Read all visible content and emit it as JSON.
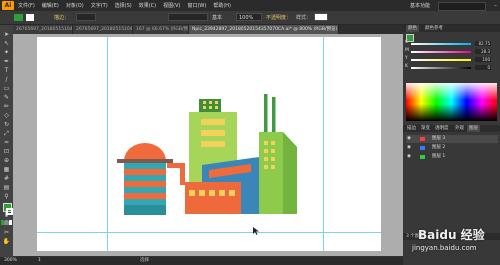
{
  "app": {
    "logo": "Ai"
  },
  "menus": [
    "文件(F)",
    "编辑(E)",
    "对象(O)",
    "文字(T)",
    "选择(S)",
    "效果(C)",
    "视图(V)",
    "窗口(W)",
    "帮助(H)"
  ],
  "workspace": "基本功能",
  "control": {
    "stroke_label": "描边：",
    "stroke_preset": "基本",
    "opacity_label": "不透明度：",
    "opacity_value": "100%",
    "style_label": "样式："
  },
  "tabs": [
    {
      "label": "26765697_2018051510451274.ai* @ 300% (RGB/预览)",
      "active": false
    },
    {
      "label": "26765697_2018051510451274.ai* @ 300%",
      "active": false
    },
    {
      "label": "167 @ 66.67% (RGB/预览)",
      "active": false
    },
    {
      "label": "Npic_23942897_20180520154357070CA.ai* @ 800% (RGB/预览)",
      "active": true
    }
  ],
  "status": {
    "zoom": "300%",
    "page": "1",
    "tool_name": "选择"
  },
  "colors": {
    "fill": "#2e9e3a",
    "brand": "#ff9a00",
    "guide": "#7fd3e8",
    "canvas_gray": "#adadad"
  },
  "panel_tabs_top": [
    "颜色",
    "颜色参考"
  ],
  "color_sliders": [
    {
      "label": "C",
      "value": "82.75"
    },
    {
      "label": "M",
      "value": "28.3"
    },
    {
      "label": "Y",
      "value": "100"
    },
    {
      "label": "K",
      "value": "0"
    }
  ],
  "panel_tabs_bottom": [
    "描边",
    "渐变",
    "透明度",
    "外观",
    "图层"
  ],
  "layers": [
    {
      "name": "图层 3"
    },
    {
      "name": "图层 2"
    },
    {
      "name": "图层 1"
    }
  ],
  "layer_count": "3 个图层",
  "watermark": {
    "text": "Baidu 经验",
    "url": "jingyan.baidu.com"
  },
  "icons": {
    "selection": "arrow-icon",
    "direct": "direct-select-icon",
    "pen": "pen-icon",
    "text": "type-icon"
  }
}
